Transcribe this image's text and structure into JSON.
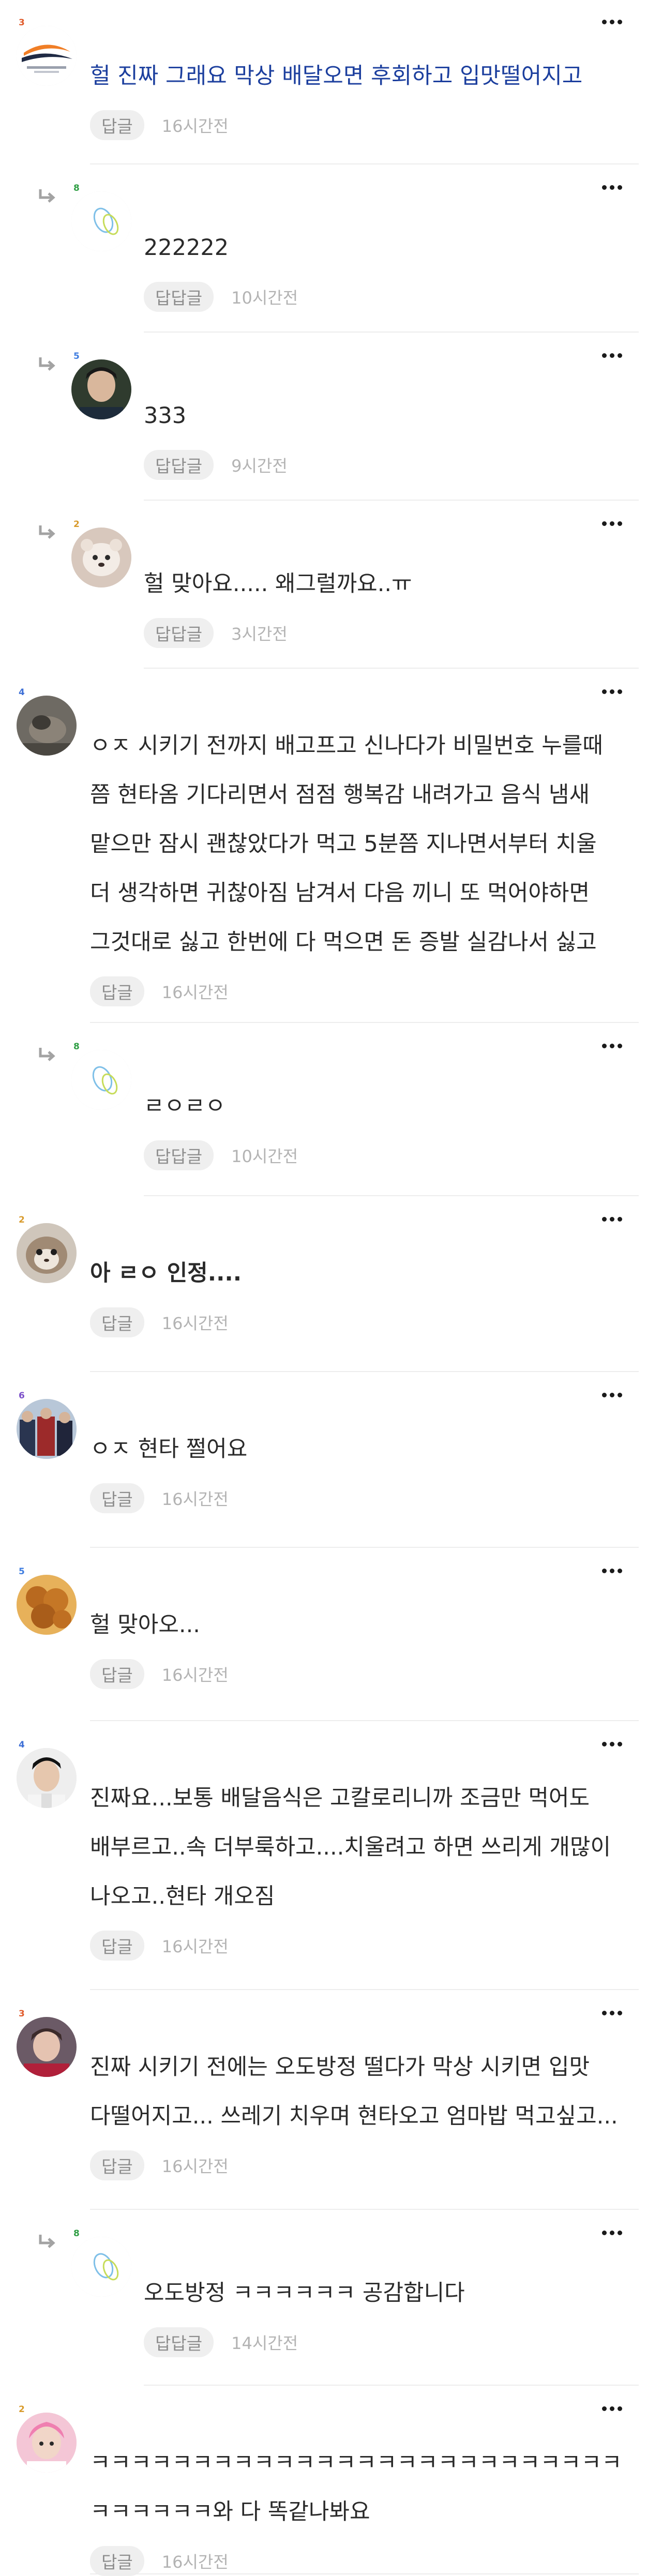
{
  "comments": [
    {
      "id": "c1",
      "type": "comment",
      "level": "3",
      "text": [
        "헐 진짜 그래요 막상 배달오면 후회하고 입맛떨어지고"
      ],
      "reply_label": "답글",
      "time": "16시간전",
      "text_color": "#1c3f9e"
    },
    {
      "id": "c2",
      "type": "reply",
      "level": "8",
      "text": [
        "222222"
      ],
      "reply_label": "답답글",
      "time": "10시간전"
    },
    {
      "id": "c3",
      "type": "reply",
      "level": "5",
      "text": [
        "333"
      ],
      "reply_label": "답답글",
      "time": "9시간전"
    },
    {
      "id": "c4",
      "type": "reply",
      "level": "2",
      "text": [
        "헐 맞아요..... 왜그럴까요..ㅠ"
      ],
      "reply_label": "답답글",
      "time": "3시간전"
    },
    {
      "id": "c5",
      "type": "comment",
      "level": "4",
      "text": [
        "ㅇㅈ 시키기 전까지 배고프고 신나다가 비밀번호 누를때",
        "쯤 현타옴 기다리면서 점점 행복감 내려가고 음식 냄새",
        "맡으만 잠시 괜찮았다가 먹고 5분쯤 지나면서부터 치울",
        "더 생각하면 귀찮아짐 남겨서 다음 끼니 또 먹어야하면",
        "그것대로 싫고 한번에 다 먹으면 돈 증발 실감나서 싫고"
      ],
      "reply_label": "답글",
      "time": "16시간전"
    },
    {
      "id": "c6",
      "type": "reply",
      "level": "8",
      "text": [
        "ㄹㅇㄹㅇ"
      ],
      "reply_label": "답답글",
      "time": "10시간전"
    },
    {
      "id": "c7",
      "type": "comment",
      "level": "2",
      "text": [
        "아 ㄹㅇ 인정...."
      ],
      "bold": true,
      "reply_label": "답글",
      "time": "16시간전"
    },
    {
      "id": "c8",
      "type": "comment",
      "level": "6",
      "text": [
        "ㅇㅈ 현타 쩔어요"
      ],
      "reply_label": "답글",
      "time": "16시간전"
    },
    {
      "id": "c9",
      "type": "comment",
      "level": "5",
      "text": [
        "헐 맞아오..."
      ],
      "reply_label": "답글",
      "time": "16시간전"
    },
    {
      "id": "c10",
      "type": "comment",
      "level": "4",
      "text": [
        "진짜요...보통 배달음식은 고칼로리니까 조금만 먹어도",
        "배부르고..속 더부룩하고....치울려고 하면 쓰리게 개많이",
        "나오고..현타 개오짐"
      ],
      "reply_label": "답글",
      "time": "16시간전"
    },
    {
      "id": "c11",
      "type": "comment",
      "level": "3",
      "text": [
        "진짜 시키기 전에는 오도방정 떨다가 막상 시키면 입맛",
        "다떨어지고... 쓰레기 치우며 현타오고 엄마밥 먹고싶고..."
      ],
      "reply_label": "답글",
      "time": "16시간전"
    },
    {
      "id": "c12",
      "type": "reply",
      "level": "8",
      "text": [
        "오도방정 ㅋㅋㅋㅋㅋㅋ 공감합니다"
      ],
      "reply_label": "답답글",
      "time": "14시간전"
    },
    {
      "id": "c13",
      "type": "comment",
      "level": "2",
      "text": [
        "ㅋㅋㅋㅋㅋㅋㅋㅋㅋㅋㅋㅋㅋㅋㅋㅋㅋㅋㅋㅋㅋㅋㅋㅋㅋㅋ",
        "ㅋㅋㅋㅋㅋㅋ와 다 똑같나봐요"
      ],
      "reply_label": "답글",
      "time": "16시간전"
    }
  ],
  "colors": {
    "level_badges": {
      "2": "#d89a2b",
      "3": "#e05a2a",
      "4": "#3d6fd6",
      "5": "#3f7de0",
      "6": "#7b4fc9",
      "8": "#2f9e44"
    },
    "reply_arrow": "#a3a3a3"
  },
  "icons": {
    "more": "more-vertical-dots-icon",
    "reply": "reply-arrow-icon"
  }
}
